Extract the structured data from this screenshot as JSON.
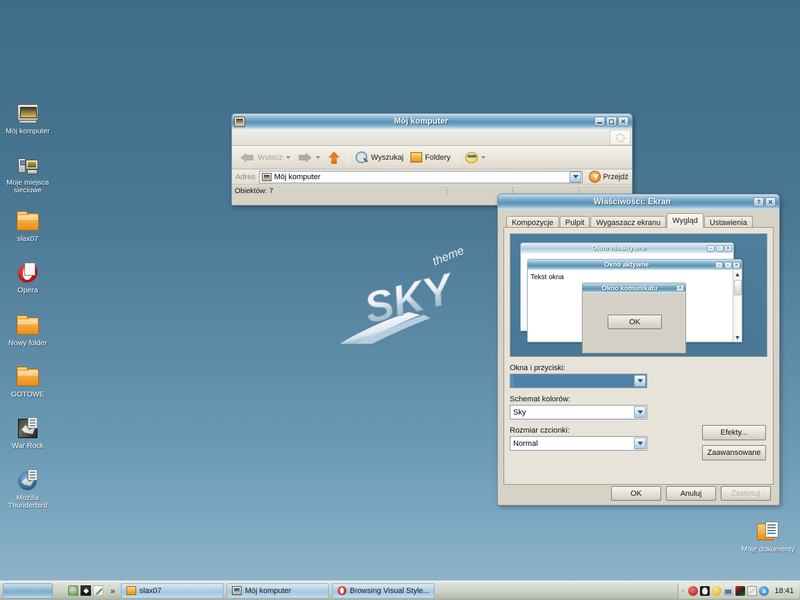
{
  "desktop": {
    "wallpaper_text": "SKY",
    "wallpaper_superscript": "theme",
    "background_color": "#4a7793",
    "icons": [
      {
        "name": "my-computer",
        "label": "Mój komputer",
        "icon": "computer-icon"
      },
      {
        "name": "network-places",
        "label": "Moje miejsca\nsieciowe",
        "icon": "network-places-icon"
      },
      {
        "name": "slax07",
        "label": "slax07",
        "icon": "folder-icon"
      },
      {
        "name": "opera",
        "label": "Opera",
        "icon": "opera-icon"
      },
      {
        "name": "nowy-folder",
        "label": "Nowy folder",
        "icon": "folder-icon"
      },
      {
        "name": "gotowe",
        "label": "GOTOWE",
        "icon": "folder-icon"
      },
      {
        "name": "war-rock",
        "label": "War Rock",
        "icon": "warrock-shortcut-icon"
      },
      {
        "name": "mozilla-thunderbird",
        "label": "Mozilla\nThunderbird",
        "icon": "thunderbird-shortcut-icon"
      },
      {
        "name": "my-documents",
        "label": "Moje dokumenty",
        "icon": "documents-icon"
      }
    ]
  },
  "explorer": {
    "title": "Mój komputer",
    "titlebar_buttons": {
      "minimize": "minimize-icon",
      "maximize": "maximize-icon",
      "close": "close-icon"
    },
    "toolbar": {
      "back_label": "Wstecz",
      "forward_label": "",
      "up_label": "",
      "search_label": "Wyszukaj",
      "folders_label": "Foldery",
      "views_label": ""
    },
    "address": {
      "label": "Adres",
      "value": "Mój komputer",
      "go_label": "Przejdź"
    },
    "status": {
      "objects": "Obiektów: 7"
    }
  },
  "display_properties": {
    "title": "Właściwości: Ekran",
    "titlebar_buttons": {
      "help": "help-icon",
      "close": "close-icon"
    },
    "tabs": [
      {
        "label": "Kompozycje",
        "active": false
      },
      {
        "label": "Pulpit",
        "active": false
      },
      {
        "label": "Wygaszacz ekranu",
        "active": false
      },
      {
        "label": "Wygląd",
        "active": true
      },
      {
        "label": "Ustawienia",
        "active": false
      }
    ],
    "preview": {
      "inactive_window_title": "Okno nieaktywne",
      "active_window_title": "Okno aktywne",
      "window_text": "Tekst okna",
      "message_box_title": "Okno komunikatu",
      "message_box_ok": "OK"
    },
    "fields": [
      {
        "label": "Okna i przyciski:",
        "value": "",
        "name": "windows-and-buttons"
      },
      {
        "label": "Schemat kolorów:",
        "value": "Sky",
        "name": "color-scheme"
      },
      {
        "label": "Rozmiar czcionki:",
        "value": "Normal",
        "name": "font-size"
      }
    ],
    "side_buttons": [
      {
        "label": "Efekty...",
        "name": "effects-button"
      },
      {
        "label": "Zaawansowane",
        "name": "advanced-button"
      }
    ],
    "footer_buttons": [
      {
        "label": "OK",
        "name": "ok-button",
        "disabled": false
      },
      {
        "label": "Anuluj",
        "name": "cancel-button",
        "disabled": false
      },
      {
        "label": "Zastosuj",
        "name": "apply-button",
        "disabled": true
      }
    ]
  },
  "taskbar": {
    "start_label": "",
    "quick_launch": [
      {
        "name": "quicklaunch-globe-icon"
      },
      {
        "name": "quicklaunch-shield-icon"
      },
      {
        "name": "quicklaunch-editor-icon"
      }
    ],
    "quick_launch_more": "»",
    "tasks": [
      {
        "label": "slax07",
        "icon": "folder-icon",
        "active": false
      },
      {
        "label": "Mój komputer",
        "icon": "computer-icon",
        "active": false
      },
      {
        "label": "Browsing Visual Style...",
        "icon": "opera-icon",
        "active": false
      }
    ],
    "tray": {
      "chevron": "‹",
      "icons": [
        {
          "name": "tray-audio-icon"
        },
        {
          "name": "tray-antivirus-icon"
        },
        {
          "name": "tray-smiley-icon"
        },
        {
          "name": "tray-network-icon"
        },
        {
          "name": "tray-display-icon"
        },
        {
          "name": "tray-mail-icon"
        },
        {
          "name": "tray-updates-icon"
        }
      ],
      "clock": "18:41"
    }
  }
}
